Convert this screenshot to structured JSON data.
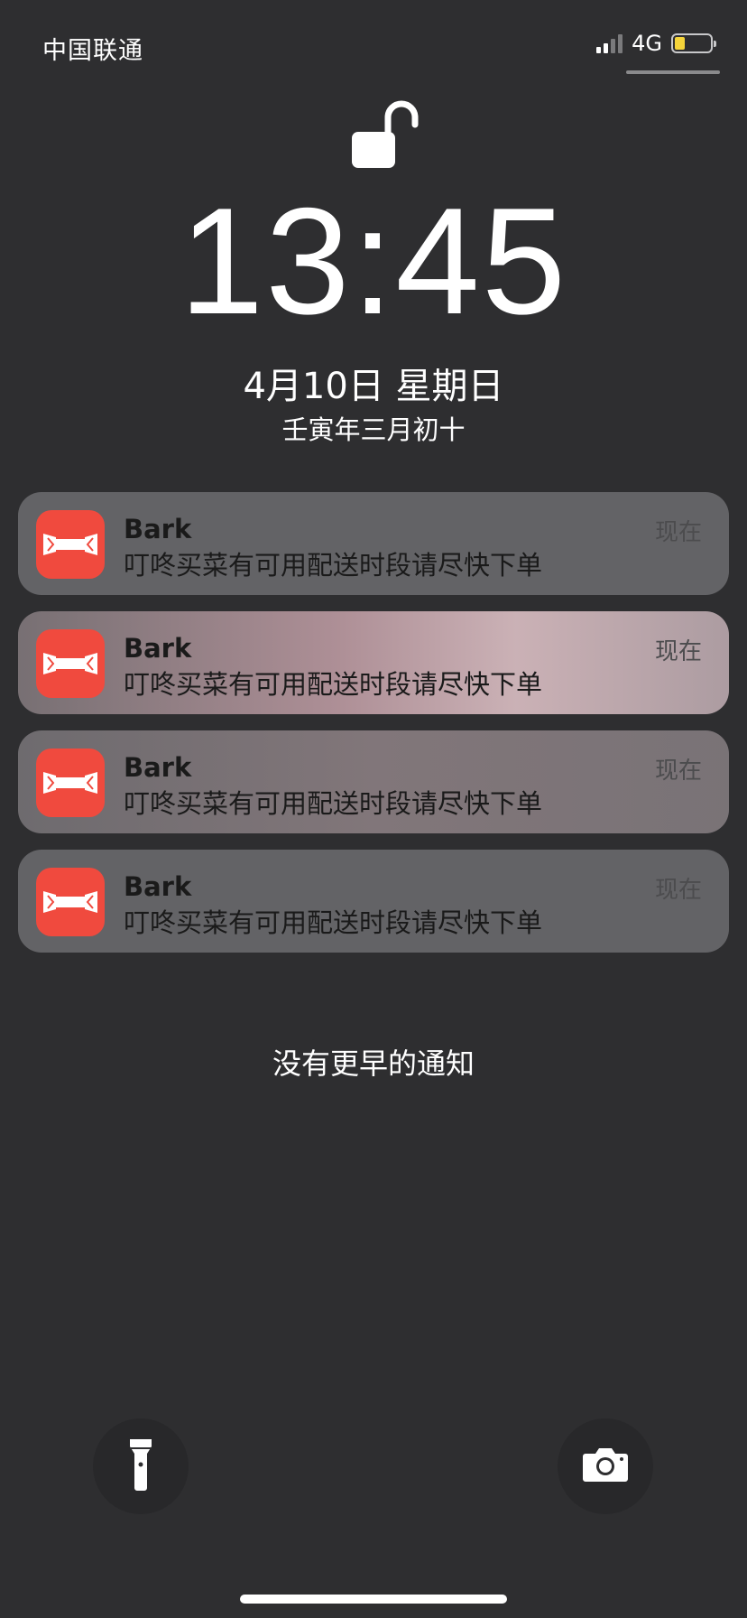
{
  "status_bar": {
    "carrier": "中国联通",
    "network": "4G",
    "battery_level": 0.3,
    "signal_bars": 2,
    "signal_max": 4,
    "battery_color": "#f5d43a"
  },
  "lock_screen": {
    "time": "13:45",
    "date": "4月10日 星期日",
    "lunar_date": "壬寅年三月初十",
    "no_more_notifications": "没有更早的通知"
  },
  "notifications": [
    {
      "app": "Bark",
      "time": "现在",
      "body": "叮咚买菜有可用配送时段请尽快下单"
    },
    {
      "app": "Bark",
      "time": "现在",
      "body": "叮咚买菜有可用配送时段请尽快下单"
    },
    {
      "app": "Bark",
      "time": "现在",
      "body": "叮咚买菜有可用配送时段请尽快下单"
    },
    {
      "app": "Bark",
      "time": "现在",
      "body": "叮咚买菜有可用配送时段请尽快下单"
    }
  ],
  "icons": {
    "lock": "unlocked-padlock-icon",
    "app": "bark-app-icon",
    "flashlight": "flashlight-icon",
    "camera": "camera-icon"
  },
  "colors": {
    "app_icon": "#f04a3e",
    "background": "#2e2e30"
  }
}
